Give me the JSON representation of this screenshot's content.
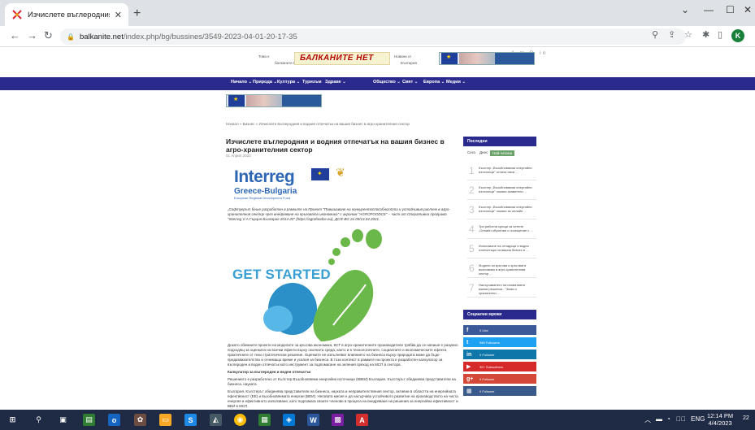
{
  "browser": {
    "tab_title": "Изчислете въглеродния и водн...",
    "new_tab": "+",
    "close": "✕",
    "url_domain": "balkanite.net",
    "url_path": "/index.php/bg/bussines/3549-2023-04-01-20-17-35",
    "profile_initial": "K"
  },
  "site": {
    "social_icons": "f ✉ P in",
    "header_small_left": "Това е",
    "header_small_left2": "балканите.бг",
    "logo": "БАЛКАНИТЕ  НЕТ",
    "header_small_right": "Новини от",
    "header_small_right2": "България",
    "nav": [
      "Начало ⌄",
      "Природа ⌄",
      "Култура ⌄",
      "Туризъм",
      "Здраве ⌄",
      "Общество ⌄",
      "Свят ⌄",
      "Европа ⌄",
      "Медии ⌄"
    ],
    "breadcrumb": "Начало  »  Бизнес  »  Изчислете въглеродния и водния отпечатък на вашия бизнес в агро-хранителния сектор",
    "article_title": "Изчислете въглеродния и водния отпечатък на вашия бизнес в агро-хранителния сектор",
    "article_date": "01 Април 2023",
    "interreg_word": "Interreg",
    "interreg_sub": "Greece-Bulgaria",
    "interreg_erdf": "European Regional Development Fund",
    "intro": "„Софтуерът беше разработен в рамките на Проект \"Повишаване на конкурентоспособността и устойчивия растеж в агро-хранителния сектор чрез внедряване на кръговата икономика\" с акроним \"AGROFOODCE\" – част от Оперативна програма \"Interreg V-A Гърция България 2014-20\" (https://agrofoodce.eu), ДСФ BG 2a 09/13.04.2021.",
    "get_started": "GET STARTED",
    "body_p1": "Докато обемните проекти на моделите за кръгова икономика, КСТ в агро-хранителните производители трябва да се напише е разумно подходящ за оценката на всички ефекти върху околната среда, както и в технологичните, социалните и икономическите ефекти, практичните от тези стратегически решения. Оценките не изпълняват влиянието на бизнеса върху природата може да бъде предизвикателство и отнемащо време и усилия за бизнеса. В този контекст в рамките на проекта е разработен калкулатор за въглероден и воден отпечатък като инструмент за подпомагане на зеления преход на МСП в сектора.",
    "body_h": "Калкулатор за въглероден и воден отпечатък",
    "body_p2": "Решението е разработено от Кълстер Възобновяеми енергийни източници (КВЕИ) България. Кълстерът обединява представители на бизнеса, науката",
    "body_p3": "България. Кълстерът обединява представители на бизнеса, науката и неправителствения сектор, активни в областта на енергийната ефективност (ЕЕ) и възобновяемата енергия (ВЕИ). Неговата мисия е да насърчава устойчивото развитие на производството на чиста енергия и ефективното използване, като подпомага своите членове в процеса на внедряване на решения за енергийна ефективност и ВЕИ в МСП.",
    "sidebar_head": "Последни",
    "sidebar_tabs": [
      "Сега",
      "Днес",
      "Най-четени"
    ],
    "sidebar_items": [
      "Кълстер „Възобновяеми енергийни източници\" отличи свои ...",
      "Кълстер „Възобновяеми енергийни източници\" покани заявители ...",
      "Кълстер „Възобновяеми енергийни източници\" покани за онлайн ...",
      "Три работни срещи за четене „Онлайн обучение с посещение с ...",
      "Използване на отпадъци и водни отпечатъци на вашия бизнес в ...",
      "Модели за кръгова и кръговата икономика в агро-хранителния сектор ...",
      "Насърчаването на иновативни малки решения - \"Земя и хранителни ..."
    ],
    "social_head": "Социални мрежи",
    "social": [
      {
        "icon": "f",
        "label": "0   Like",
        "color": "#3b5998"
      },
      {
        "icon": "t",
        "label": "965   Followers",
        "color": "#1da1f2"
      },
      {
        "icon": "in",
        "label": "0   Follower",
        "color": "#0e76a8"
      },
      {
        "icon": "▶",
        "label": "30+   Subscribers",
        "color": "#d62a2a"
      },
      {
        "icon": "g+",
        "label": "0   Follower",
        "color": "#d34836"
      },
      {
        "icon": "▦",
        "label": "0   Follower",
        "color": "#3a5a8c"
      }
    ]
  },
  "taskbar": {
    "lang": "ENG",
    "time": "12:14 PM",
    "date": "4/4/2023",
    "notify": "22"
  }
}
